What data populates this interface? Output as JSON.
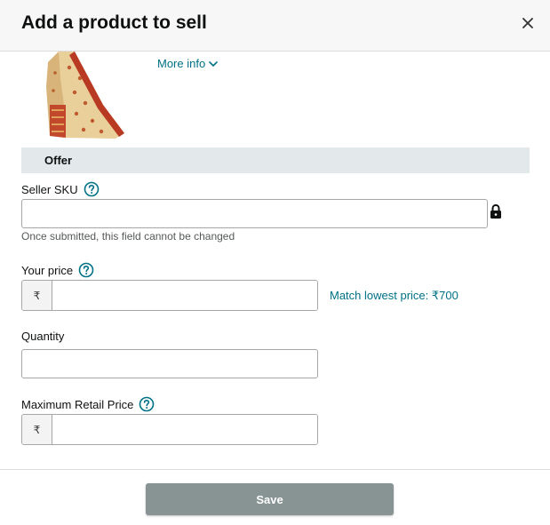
{
  "header": {
    "title": "Add a product to sell"
  },
  "product": {
    "more_info_label": "More info"
  },
  "offer_section": {
    "title": "Offer"
  },
  "fields": {
    "seller_sku": {
      "label": "Seller SKU",
      "value": "",
      "hint": "Once submitted, this field cannot be changed"
    },
    "your_price": {
      "label": "Your price",
      "currency_symbol": "₹",
      "value": "",
      "match_link": "Match lowest price: ₹700"
    },
    "quantity": {
      "label": "Quantity",
      "value": ""
    },
    "mrp": {
      "label": "Maximum Retail Price",
      "currency_symbol": "₹",
      "value": ""
    }
  },
  "footer": {
    "save_label": "Save"
  },
  "colors": {
    "link": "#007185",
    "save_button": "#889394",
    "section_bar": "#e3e8ea",
    "header_bg": "#f7f7f7"
  },
  "icons": [
    "close-icon",
    "chevron-down-icon",
    "help-icon",
    "lock-icon"
  ]
}
